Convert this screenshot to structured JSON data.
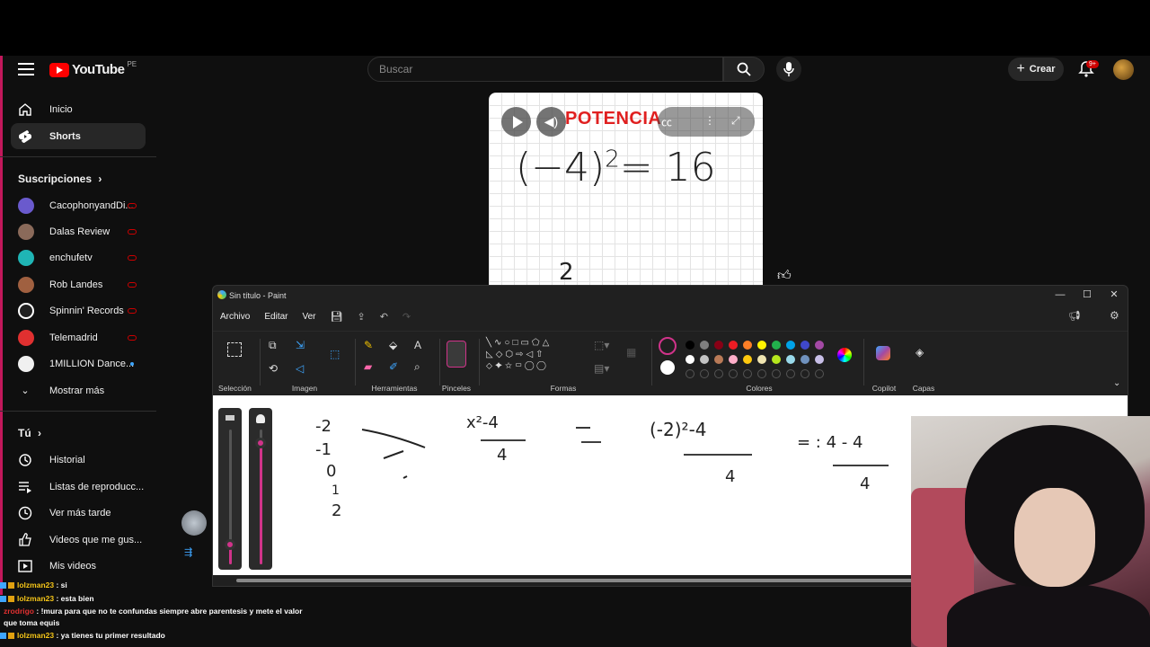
{
  "youtube": {
    "logo_text": "YouTube",
    "region": "PE",
    "search_placeholder": "Buscar",
    "create_label": "Crear",
    "notif_badge": "9+",
    "nav": [
      {
        "label": "Inicio",
        "icon": "home-icon"
      },
      {
        "label": "Shorts",
        "icon": "shorts-icon",
        "active": true
      }
    ],
    "subs_title": "Suscripciones",
    "subs": [
      {
        "label": "CacophonyandDi...",
        "color": "#6a5acd",
        "status": "live"
      },
      {
        "label": "Dalas Review",
        "color": "#8a6a5a",
        "status": "live"
      },
      {
        "label": "enchufetv",
        "color": "#1fb5b5",
        "status": "live"
      },
      {
        "label": "Rob Landes",
        "color": "#a06040",
        "status": "live"
      },
      {
        "label": "Spinnin' Records",
        "color": "#202020",
        "status": "live"
      },
      {
        "label": "Telemadrid",
        "color": "#e03030",
        "status": "live"
      },
      {
        "label": "1MILLION Dance...",
        "color": "#f0f0f0",
        "status": "new"
      }
    ],
    "show_more": "Mostrar más",
    "you_title": "Tú",
    "you": [
      {
        "label": "Historial",
        "icon": "history-icon"
      },
      {
        "label": "Listas de reproducc...",
        "icon": "playlist-icon"
      },
      {
        "label": "Ver más tarde",
        "icon": "watch-later-icon"
      },
      {
        "label": "Videos que me gus...",
        "icon": "like-icon"
      },
      {
        "label": "Mis videos",
        "icon": "my-videos-icon"
      }
    ]
  },
  "short": {
    "title": "POTENCIA",
    "equation": "(−4)",
    "exponent": "2",
    "result": "= 16",
    "next_exp": "2"
  },
  "paint": {
    "window_title": "Sin título - Paint",
    "menu": [
      "Archivo",
      "Editar",
      "Ver"
    ],
    "groups": [
      "Selección",
      "Imagen",
      "Herramientas",
      "Pinceles",
      "Formas",
      "Colores",
      "Copilot",
      "Capas"
    ],
    "palette": [
      "#000000",
      "#7f7f7f",
      "#880015",
      "#ed1c24",
      "#ff7f27",
      "#fff200",
      "#22b14c",
      "#00a2e8",
      "#3f48cc",
      "#a349a4",
      "#ffffff",
      "#c3c3c3",
      "#b97a57",
      "#ffaec9",
      "#ffc90e",
      "#efe4b0",
      "#b5e61d",
      "#99d9ea",
      "#7092be",
      "#c8bfe7"
    ],
    "primary_color": "#202020",
    "secondary_color": "#ffffff",
    "brush_size_fraction": 0.9,
    "opacity_fraction": 0.15,
    "handwriting": {
      "col1": [
        "-2",
        "-1",
        "0",
        "1",
        "2"
      ],
      "expr1": "x²-4",
      "den1": "4",
      "expr2": "(-2)²-4",
      "den2": "4",
      "expr3": "= : 4 - 4",
      "den3": "4"
    }
  },
  "chat": [
    {
      "user": "lolzman23",
      "msg": ": si"
    },
    {
      "user": "lolzman23",
      "msg": ": esta bien"
    },
    {
      "user": "zrodrigo",
      "msg": ": !mura para que no te confundas siempre abre parentesis y mete el valor que toma equis"
    },
    {
      "user": "lolzman23",
      "msg": ": ya tienes tu primer resultado"
    }
  ]
}
